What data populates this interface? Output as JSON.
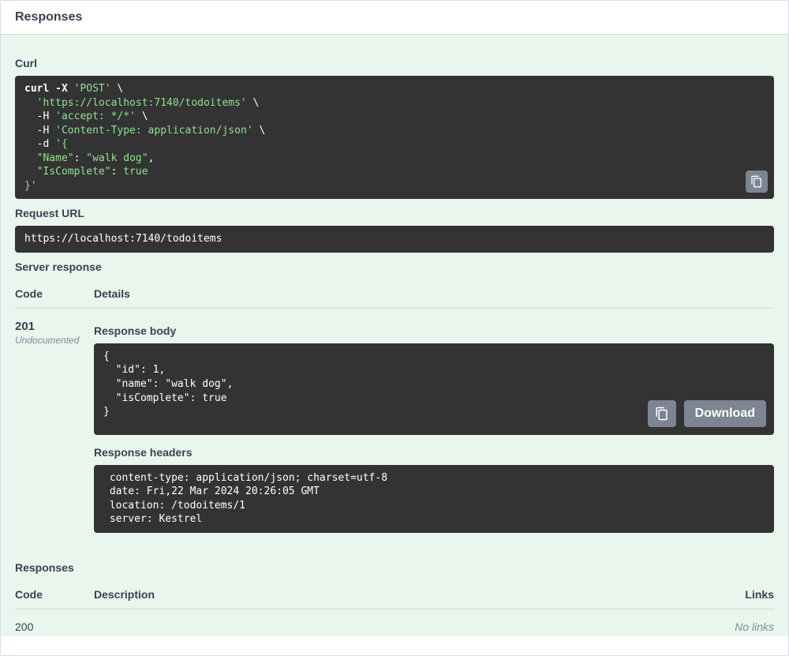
{
  "header": {
    "title": "Responses"
  },
  "curl": {
    "label": "Curl",
    "line1a": "curl -X ",
    "line1b": "'POST'",
    "line1c": " \\",
    "line2a": "  ",
    "line2b": "'https://localhost:7140/todoitems'",
    "line2c": " \\",
    "line3a": "  -H ",
    "line3b": "'accept: */*'",
    "line3c": " \\",
    "line4a": "  -H ",
    "line4b": "'Content-Type: application/json'",
    "line4c": " \\",
    "line5a": "  -d ",
    "line5b": "'{",
    "line6a": "  ",
    "line6key": "\"Name\"",
    "line6sep": ": ",
    "line6val": "\"walk dog\"",
    "line6end": ",",
    "line7a": "  ",
    "line7key": "\"IsComplete\"",
    "line7sep": ": ",
    "line7val": "true",
    "line8": "}'"
  },
  "request_url": {
    "label": "Request URL",
    "value": "https://localhost:7140/todoitems"
  },
  "server_response": {
    "label": "Server response",
    "code_header": "Code",
    "details_header": "Details",
    "code": "201",
    "undocumented": "Undocumented",
    "body_label": "Response body",
    "body": {
      "open": "{",
      "l1indent": "  ",
      "l1key": "\"id\"",
      "l1sep": ": ",
      "l1val": "1",
      "l1end": ",",
      "l2indent": "  ",
      "l2key": "\"name\"",
      "l2sep": ": ",
      "l2val": "\"walk dog\"",
      "l2end": ",",
      "l3indent": "  ",
      "l3key": "\"isComplete\"",
      "l3sep": ": ",
      "l3val": "true",
      "close": "}"
    },
    "download": "Download",
    "headers_label": "Response headers",
    "headers": " content-type: application/json; charset=utf-8 \n date: Fri,22 Mar 2024 20:26:05 GMT \n location: /todoitems/1 \n server: Kestrel "
  },
  "responses2": {
    "label": "Responses",
    "code_header": "Code",
    "desc_header": "Description",
    "links_header": "Links",
    "code": "200",
    "links": "No links"
  }
}
